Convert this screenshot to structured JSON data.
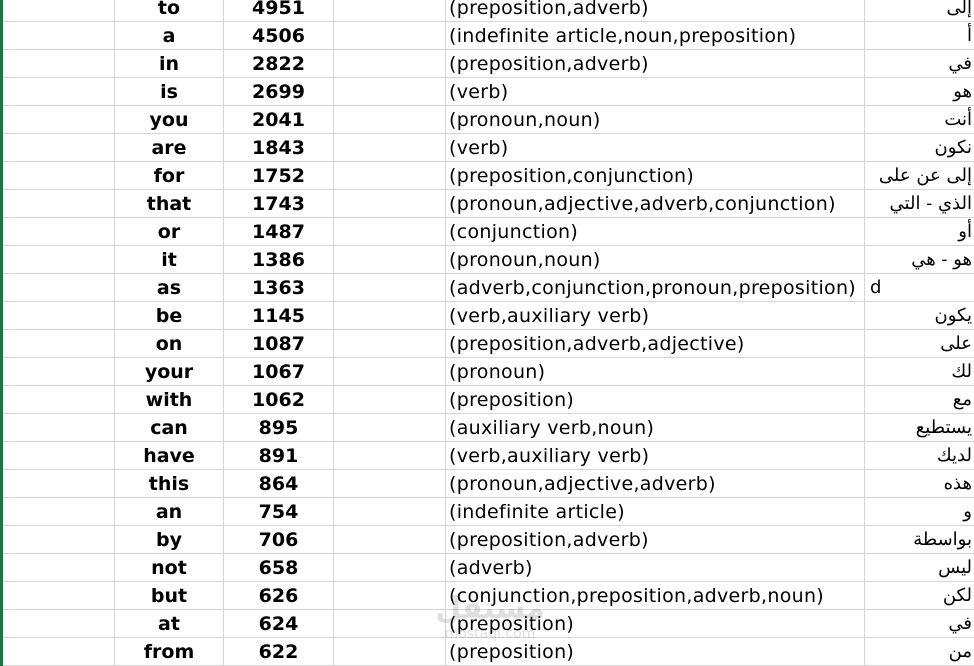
{
  "rows": [
    {
      "word": "to",
      "count": "4951",
      "pos": "(preposition,adverb)",
      "ar": "إلى",
      "extra": ""
    },
    {
      "word": "a",
      "count": "4506",
      "pos": "(indefinite article,noun,preposition)",
      "ar": "أ",
      "extra": ""
    },
    {
      "word": "in",
      "count": "2822",
      "pos": "(preposition,adverb)",
      "ar": "في",
      "extra": ""
    },
    {
      "word": "is",
      "count": "2699",
      "pos": "(verb)",
      "ar": "هو",
      "extra": ""
    },
    {
      "word": "you",
      "count": "2041",
      "pos": "(pronoun,noun)",
      "ar": "أنت",
      "extra": ""
    },
    {
      "word": "are",
      "count": "1843",
      "pos": "(verb)",
      "ar": "نكون",
      "extra": ""
    },
    {
      "word": "for",
      "count": "1752",
      "pos": "(preposition,conjunction)",
      "ar": "إلى عن على",
      "extra": ""
    },
    {
      "word": "that",
      "count": "1743",
      "pos": "(pronoun,adjective,adverb,conjunction)",
      "ar": "الذي - التي",
      "extra": ""
    },
    {
      "word": "or",
      "count": "1487",
      "pos": "(conjunction)",
      "ar": "أو",
      "extra": ""
    },
    {
      "word": "it",
      "count": "1386",
      "pos": "(pronoun,noun)",
      "ar": "هو - هي",
      "extra": ""
    },
    {
      "word": "as",
      "count": "1363",
      "pos": "(adverb,conjunction,pronoun,preposition)",
      "ar": "",
      "extra": "d"
    },
    {
      "word": "be",
      "count": "1145",
      "pos": "(verb,auxiliary verb)",
      "ar": "يكون",
      "extra": ""
    },
    {
      "word": "on",
      "count": "1087",
      "pos": "(preposition,adverb,adjective)",
      "ar": "على",
      "extra": ""
    },
    {
      "word": "your",
      "count": "1067",
      "pos": "(pronoun)",
      "ar": "لك",
      "extra": ""
    },
    {
      "word": "with",
      "count": "1062",
      "pos": "(preposition)",
      "ar": "مع",
      "extra": ""
    },
    {
      "word": "can",
      "count": "895",
      "pos": "(auxiliary verb,noun)",
      "ar": "يستطيع",
      "extra": ""
    },
    {
      "word": "have",
      "count": "891",
      "pos": "(verb,auxiliary verb)",
      "ar": "لديك",
      "extra": ""
    },
    {
      "word": "this",
      "count": "864",
      "pos": "(pronoun,adjective,adverb)",
      "ar": "هذه",
      "extra": ""
    },
    {
      "word": "an",
      "count": "754",
      "pos": "(indefinite article)",
      "ar": "و",
      "extra": ""
    },
    {
      "word": "by",
      "count": "706",
      "pos": "(preposition,adverb)",
      "ar": "بواسطة",
      "extra": ""
    },
    {
      "word": "not",
      "count": "658",
      "pos": "(adverb)",
      "ar": "ليس",
      "extra": ""
    },
    {
      "word": "but",
      "count": "626",
      "pos": "(conjunction,preposition,adverb,noun)",
      "ar": "لكن",
      "extra": ""
    },
    {
      "word": "at",
      "count": "624",
      "pos": "(preposition)",
      "ar": "في",
      "extra": ""
    },
    {
      "word": "from",
      "count": "622",
      "pos": "(preposition)",
      "ar": "من",
      "extra": ""
    }
  ],
  "watermark": {
    "text": "mostaql.com",
    "ar": "مستقل"
  }
}
